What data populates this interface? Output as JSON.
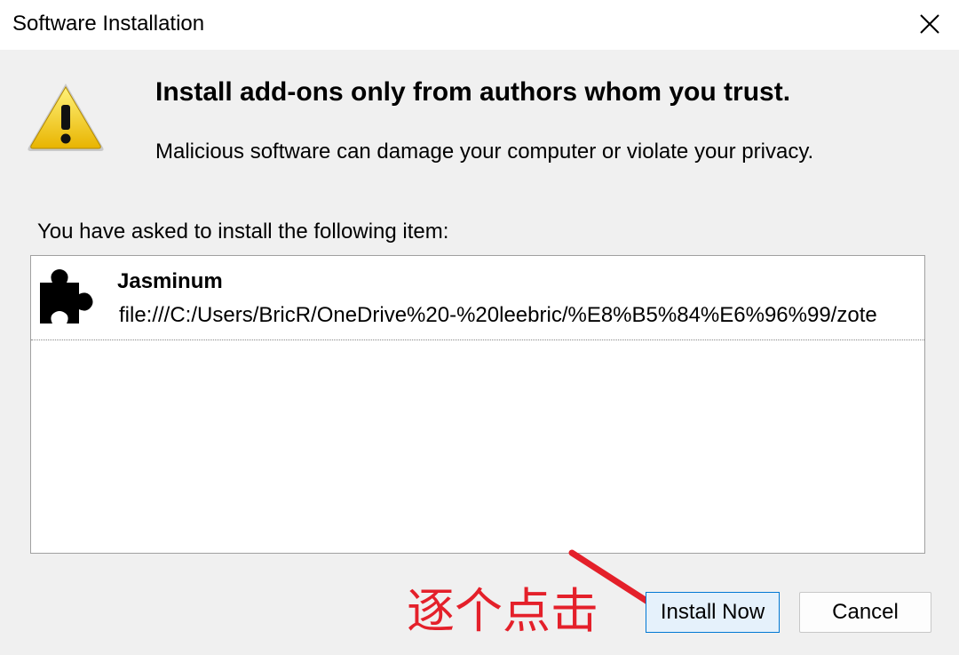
{
  "window": {
    "title": "Software Installation",
    "close_icon": "close-icon"
  },
  "warning": {
    "icon": "warning-icon",
    "headline": "Install add-ons only from authors whom you trust.",
    "subline": "Malicious software can damage your computer or violate your privacy."
  },
  "install_list": {
    "label": "You have asked to install the following item:",
    "items": [
      {
        "icon": "puzzle-piece-icon",
        "name": "Jasminum",
        "url": "file:///C:/Users/BricR/OneDrive%20-%20leebric/%E8%B5%84%E6%96%99/zote"
      }
    ]
  },
  "annotation": {
    "text": "逐个点击",
    "color": "#e4202a",
    "arrow_icon": "red-arrow-icon"
  },
  "buttons": {
    "install_now": "Install Now",
    "cancel": "Cancel"
  },
  "colors": {
    "accent_border": "#0078d4",
    "warning_yellow": "#f5c518"
  }
}
